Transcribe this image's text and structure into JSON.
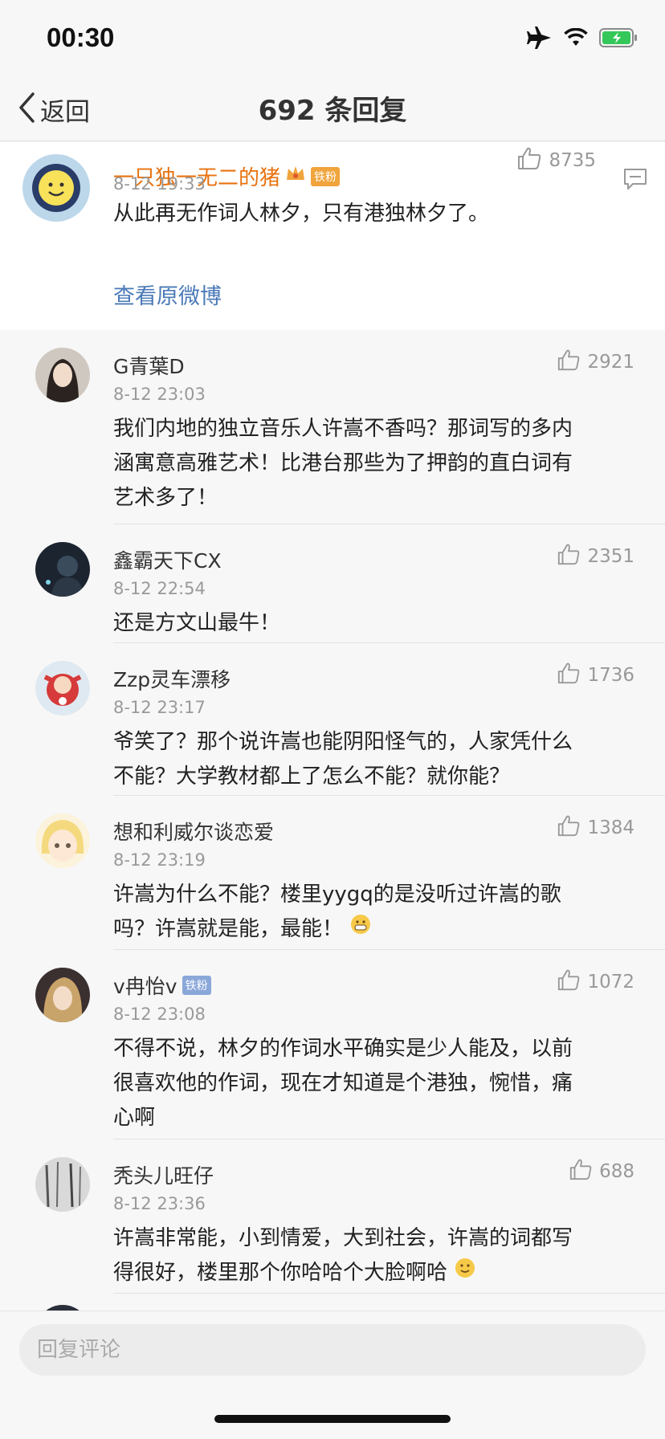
{
  "status_bar": {
    "time": "00:30"
  },
  "nav": {
    "back_label": "返回",
    "title": "692 条回复"
  },
  "original": {
    "username": "一只独一无二的猪",
    "badge": "铁粉",
    "time": "8-12 19:33",
    "likes": "8735",
    "text": "从此再无作词人林夕，只有港独林夕了。",
    "view_original": "查看原微博"
  },
  "replies": [
    {
      "username": "G青葉D",
      "time": "8-12 23:03",
      "likes": "2921",
      "lines": [
        "我们内地的独立音乐人许嵩不香吗？那词写的多内",
        "涵寓意高雅艺术！比港台那些为了押韵的直白词有",
        "艺术多了！"
      ]
    },
    {
      "username": "鑫霸天下CX",
      "time": "8-12 22:54",
      "likes": "2351",
      "lines": [
        "还是方文山最牛！"
      ]
    },
    {
      "username": "Zzp灵车漂移",
      "time": "8-12 23:17",
      "likes": "1736",
      "lines": [
        "爷笑了？那个说许嵩也能阴阳怪气的，人家凭什么",
        "不能？大学教材都上了怎么不能？就你能？"
      ]
    },
    {
      "username": "想和利威尔谈恋爱",
      "time": "8-12 23:19",
      "likes": "1384",
      "lines": [
        "许嵩为什么不能？楼里yygq的是没听过许嵩的歌",
        "吗？许嵩就是能，最能！"
      ]
    },
    {
      "username": "v冉怡v",
      "badge": "铁粉",
      "time": "8-12 23:08",
      "likes": "1072",
      "lines": [
        "不得不说，林夕的作词水平确实是少人能及，以前",
        "很喜欢他的作词，现在才知道是个港独，惋惜，痛",
        "心啊"
      ]
    },
    {
      "username": "秃头儿旺仔",
      "time": "8-12 23:36",
      "likes": "688",
      "lines": [
        "许嵩非常能，小到情爱，大到社会，许嵩的词都写",
        "得很好，楼里那个你哈哈个大脸啊哈"
      ]
    }
  ],
  "input": {
    "placeholder": "回复评论"
  },
  "colors": {
    "username_orange": "#e8720f",
    "link_blue": "#4a7ab7",
    "meta_gray": "#999999"
  }
}
